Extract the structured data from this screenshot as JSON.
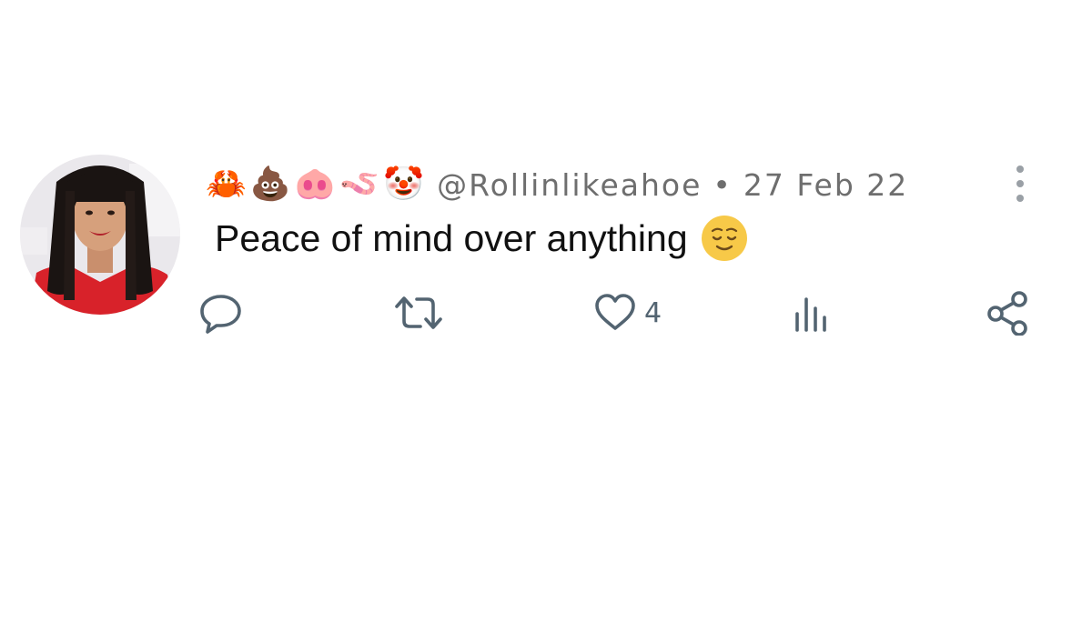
{
  "tweet": {
    "display_name_emojis": [
      "🦀",
      "💩",
      "🐽",
      "🪱",
      "🤡"
    ],
    "handle": "@Rollinlikeahoe",
    "separator": "•",
    "date": "27 Feb 22",
    "text": "Peace of mind over anything",
    "text_emoji": "relieved-face",
    "actions": {
      "reply_icon": "reply-icon",
      "retweet_icon": "retweet-icon",
      "like_icon": "heart-icon",
      "like_count": "4",
      "views_icon": "views-icon",
      "share_icon": "share-icon"
    },
    "more_icon": "more-vertical-icon"
  },
  "colors": {
    "icon": "#536471",
    "meta_text": "#6e6e6e",
    "body_text": "#111111",
    "avatar_dress": "#d8222a"
  }
}
